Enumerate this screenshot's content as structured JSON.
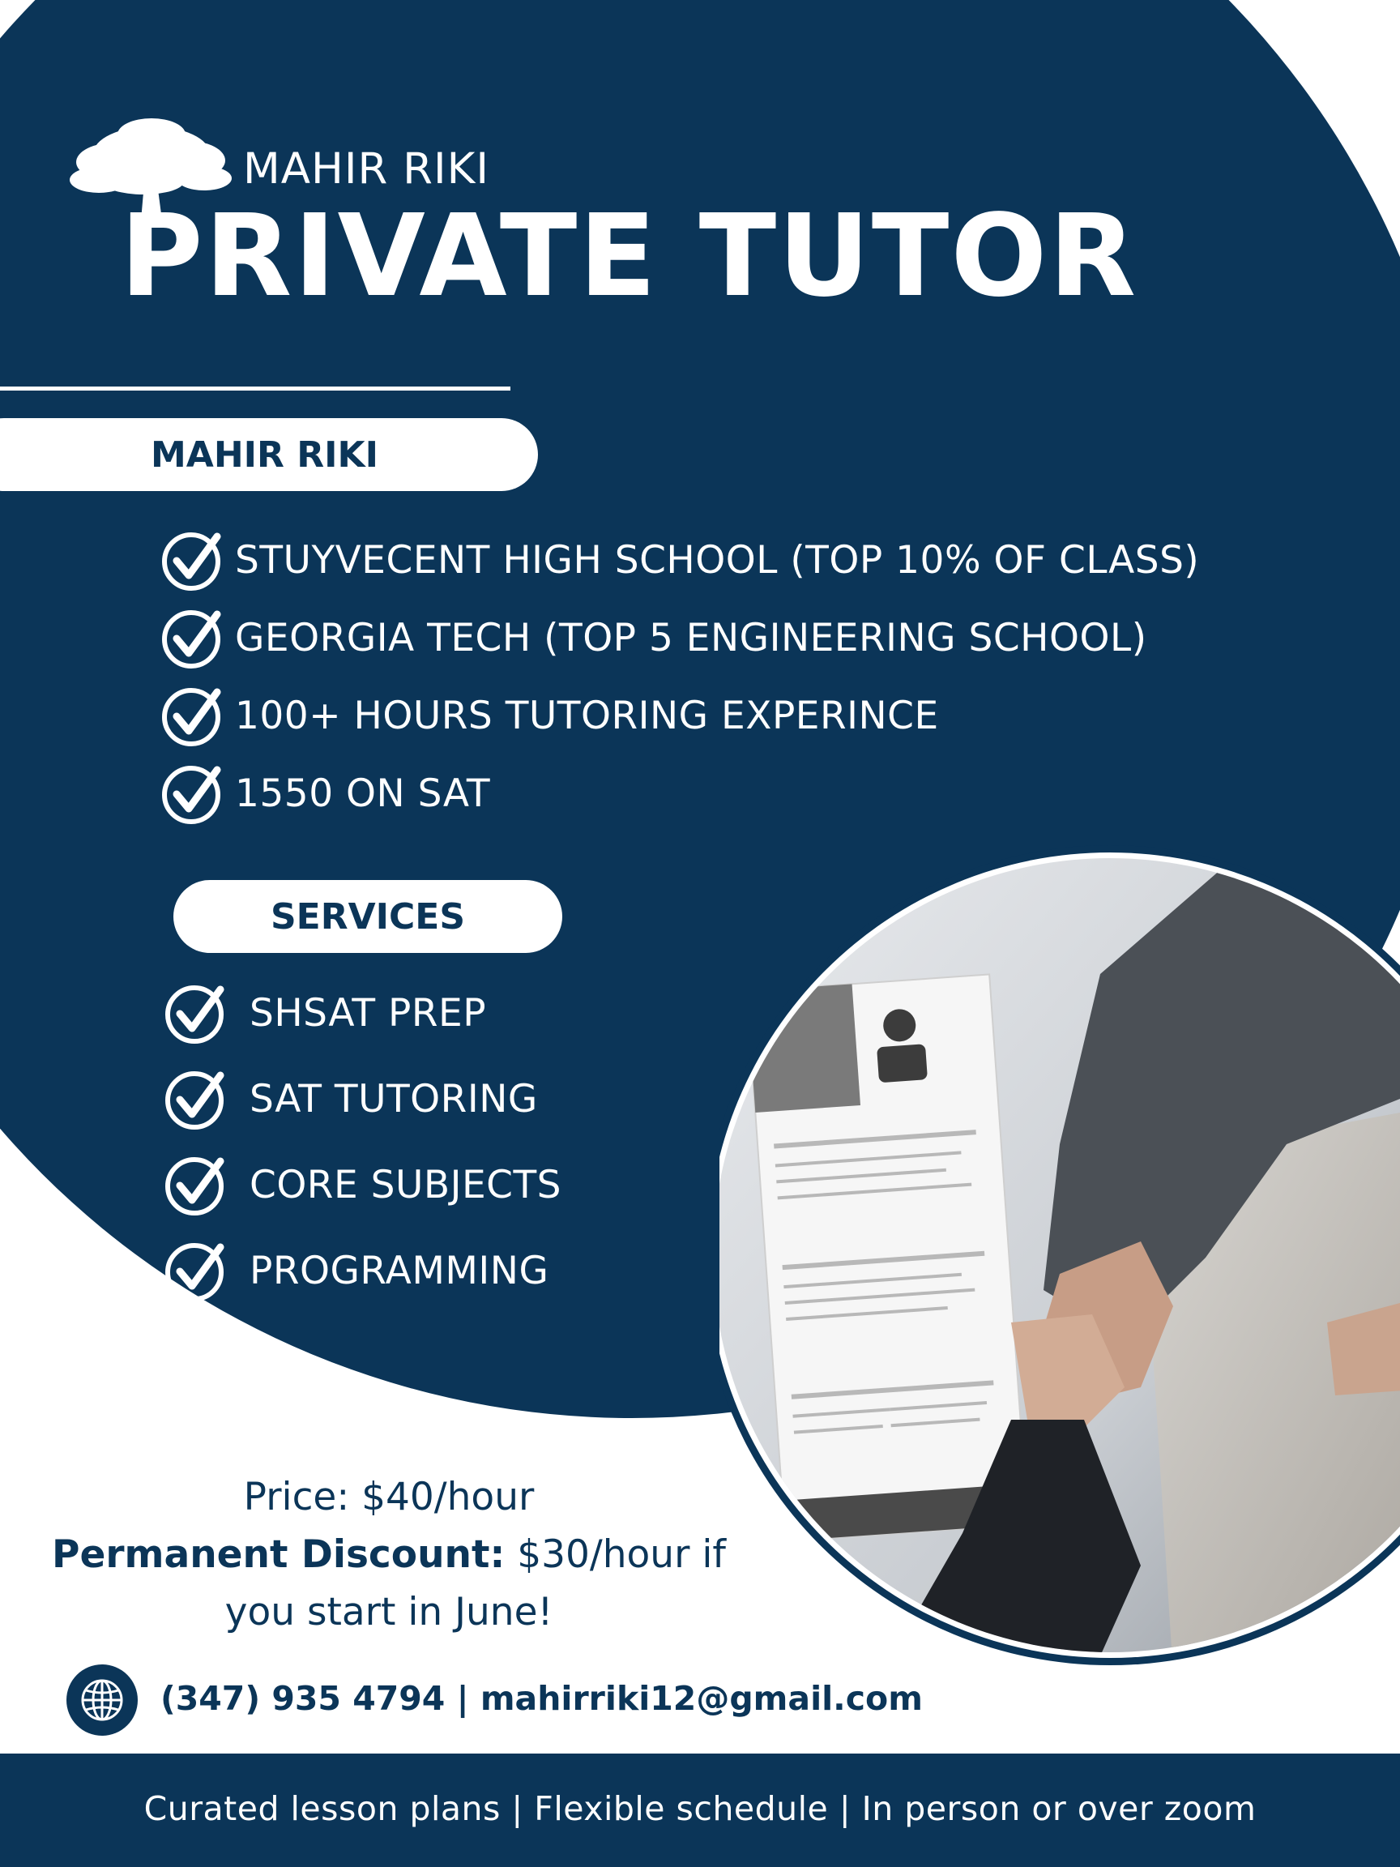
{
  "header": {
    "name": "MAHIR RIKI",
    "title": "PRIVATE TUTOR"
  },
  "credentials": {
    "heading": "MAHIR RIKI",
    "items": [
      "STUYVECENT HIGH SCHOOL (TOP 10% OF CLASS)",
      "GEORGIA TECH (TOP 5 ENGINEERING SCHOOL)",
      "100+ HOURS TUTORING EXPERINCE",
      "1550 ON SAT"
    ]
  },
  "services": {
    "heading": "SERVICES",
    "items": [
      "SHSAT PREP",
      "SAT TUTORING",
      "CORE SUBJECTS",
      "PROGRAMMING"
    ]
  },
  "pricing": {
    "price": "Price: $40/hour",
    "discount_label": "Permanent Discount:",
    "discount_value": "$30/hour if you start in June!"
  },
  "contact": {
    "icon": "globe-icon",
    "text": "(347) 935 4794 | mahirriki12@gmail.com"
  },
  "footer": {
    "text": "Curated lesson plans  |  Flexible schedule  |  In person or over zoom"
  },
  "colors": {
    "navy": "#0b3558",
    "white": "#ffffff"
  }
}
